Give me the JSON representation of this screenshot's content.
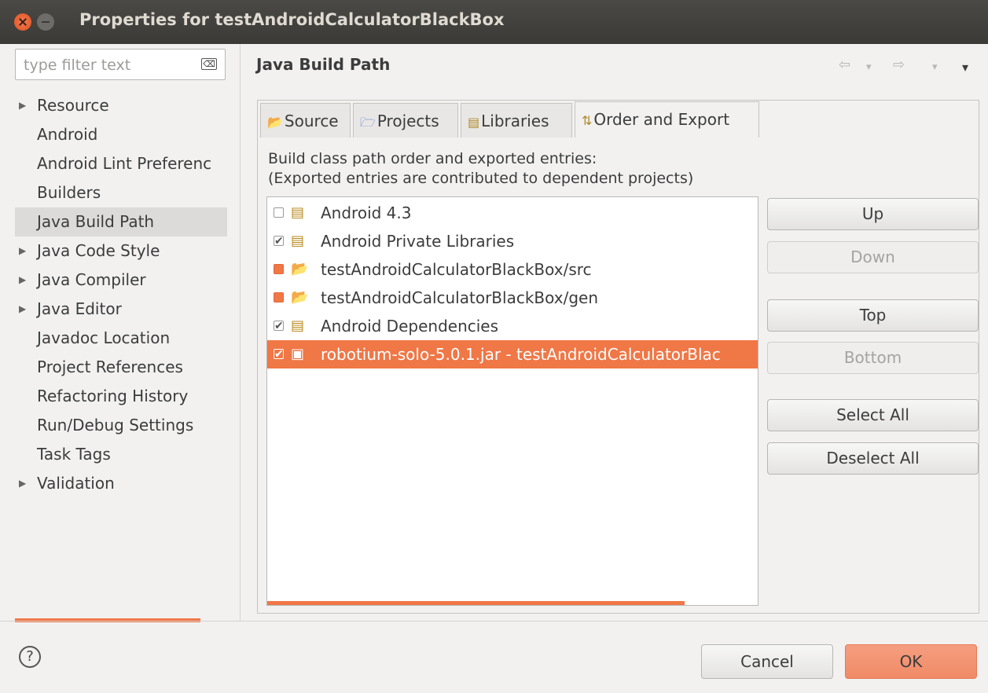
{
  "window": {
    "title": "Properties for testAndroidCalculatorBlackBox"
  },
  "filter": {
    "placeholder": "type filter text",
    "clear_glyph": "⌫"
  },
  "tree": [
    {
      "label": "Resource",
      "expandable": true
    },
    {
      "label": "Android",
      "expandable": false
    },
    {
      "label": "Android Lint Preferenc",
      "expandable": false
    },
    {
      "label": "Builders",
      "expandable": false
    },
    {
      "label": "Java Build Path",
      "expandable": false,
      "selected": true
    },
    {
      "label": "Java Code Style",
      "expandable": true
    },
    {
      "label": "Java Compiler",
      "expandable": true
    },
    {
      "label": "Java Editor",
      "expandable": true
    },
    {
      "label": "Javadoc Location",
      "expandable": false
    },
    {
      "label": "Project References",
      "expandable": false
    },
    {
      "label": "Refactoring History",
      "expandable": false
    },
    {
      "label": "Run/Debug Settings",
      "expandable": false
    },
    {
      "label": "Task Tags",
      "expandable": false
    },
    {
      "label": "Validation",
      "expandable": true
    }
  ],
  "page": {
    "title": "Java Build Path"
  },
  "nav": {
    "back": "⇦",
    "back_menu": "▾",
    "forward": "⇨",
    "forward_menu": "▾",
    "view_menu": "▾"
  },
  "tabs": [
    {
      "label": "Source",
      "icon": "source-folder-icon"
    },
    {
      "label": "Projects",
      "icon": "project-folder-icon"
    },
    {
      "label": "Libraries",
      "icon": "library-icon"
    },
    {
      "label": "Order and Export",
      "icon": "order-export-icon",
      "active": true
    }
  ],
  "description": {
    "line1": "Build class path order and exported entries:",
    "line2": "(Exported entries are contributed to dependent projects)"
  },
  "entries": [
    {
      "label": "Android 4.3",
      "icon": "library-icon",
      "checked": false
    },
    {
      "label": "Android Private Libraries",
      "icon": "library-icon",
      "checked": true
    },
    {
      "label": "testAndroidCalculatorBlackBox/src",
      "icon": "source-folder-icon",
      "checked": "partial"
    },
    {
      "label": "testAndroidCalculatorBlackBox/gen",
      "icon": "source-folder-icon",
      "checked": "partial"
    },
    {
      "label": "Android Dependencies",
      "icon": "library-icon",
      "checked": true
    },
    {
      "label": "robotium-solo-5.0.1.jar - testAndroidCalculatorBlac",
      "icon": "jar-icon",
      "checked": true,
      "selected": true
    }
  ],
  "buttons": {
    "up": "Up",
    "down": "Down",
    "top": "Top",
    "bottom": "Bottom",
    "select_all": "Select All",
    "deselect_all": "Deselect All"
  },
  "footer": {
    "help": "?",
    "cancel": "Cancel",
    "ok": "OK"
  },
  "colors": {
    "accent": "#f07746",
    "titlebar": "#3c3b37",
    "selection": "#f07746"
  }
}
